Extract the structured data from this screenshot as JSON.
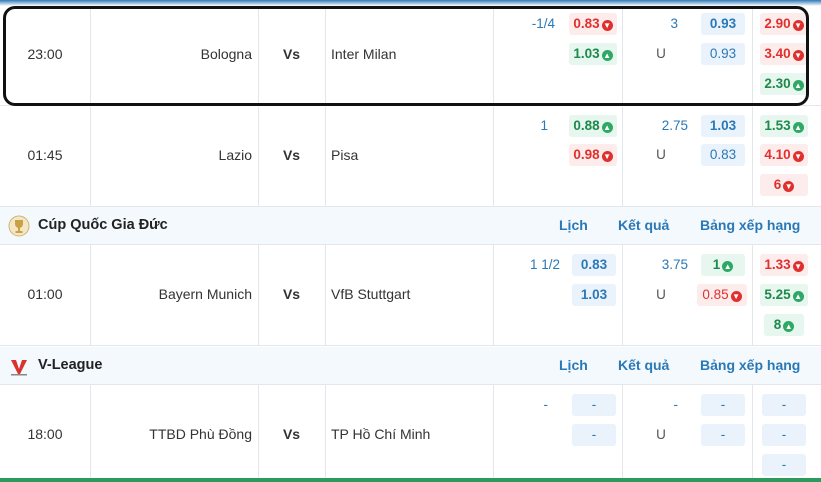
{
  "matches": [
    {
      "time": "23:00",
      "home": "Bologna",
      "vs": "Vs",
      "away": "Inter Milan",
      "hc_line": "-1/4",
      "hc_home": "0.83",
      "hc_away": "1.03",
      "ou_line": "3",
      "ou_over": "0.93",
      "ou_u": "U",
      "ou_under": "0.93",
      "x1": "2.90",
      "x2": "3.40",
      "x3": "2.30"
    },
    {
      "time": "01:45",
      "home": "Lazio",
      "vs": "Vs",
      "away": "Pisa",
      "hc_line": "1",
      "hc_home": "0.88",
      "hc_away": "0.98",
      "ou_line": "2.75",
      "ou_over": "1.03",
      "ou_u": "U",
      "ou_under": "0.83",
      "x1": "1.53",
      "x2": "4.10",
      "x3": "6"
    },
    {
      "time": "01:00",
      "home": "Bayern Munich",
      "vs": "Vs",
      "away": "VfB Stuttgart",
      "hc_line": "1 1/2",
      "hc_home": "0.83",
      "hc_away": "1.03",
      "ou_line": "3.75",
      "ou_over": "1",
      "ou_u": "U",
      "ou_under": "0.85",
      "x1": "1.33",
      "x2": "5.25",
      "x3": "8"
    },
    {
      "time": "18:00",
      "home": "TTBD Phù Đồng",
      "vs": "Vs",
      "away": "TP Hồ Chí Minh",
      "hc_line": "-",
      "hc_home": "-",
      "hc_away": "-",
      "ou_line": "-",
      "ou_over": "-",
      "ou_u": "U",
      "ou_under": "-",
      "x1": "-",
      "x2": "-",
      "x3": "-"
    }
  ],
  "leagues": [
    {
      "name": "Cúp Quốc Gia Đức",
      "icon": "german-cup-logo-icon",
      "link_schedule": "Lịch",
      "link_results": "Kết quả",
      "link_standings": "Bảng xếp hạng"
    },
    {
      "name": "V-League",
      "icon": "v-league-logo-icon",
      "link_schedule": "Lịch",
      "link_results": "Kết quả",
      "link_standings": "Bảng xếp hạng"
    }
  ],
  "colors": {
    "accent": "#2b78b6",
    "up": "#2fa866",
    "down": "#e0302e",
    "league_bg": "#f3f9fc"
  }
}
